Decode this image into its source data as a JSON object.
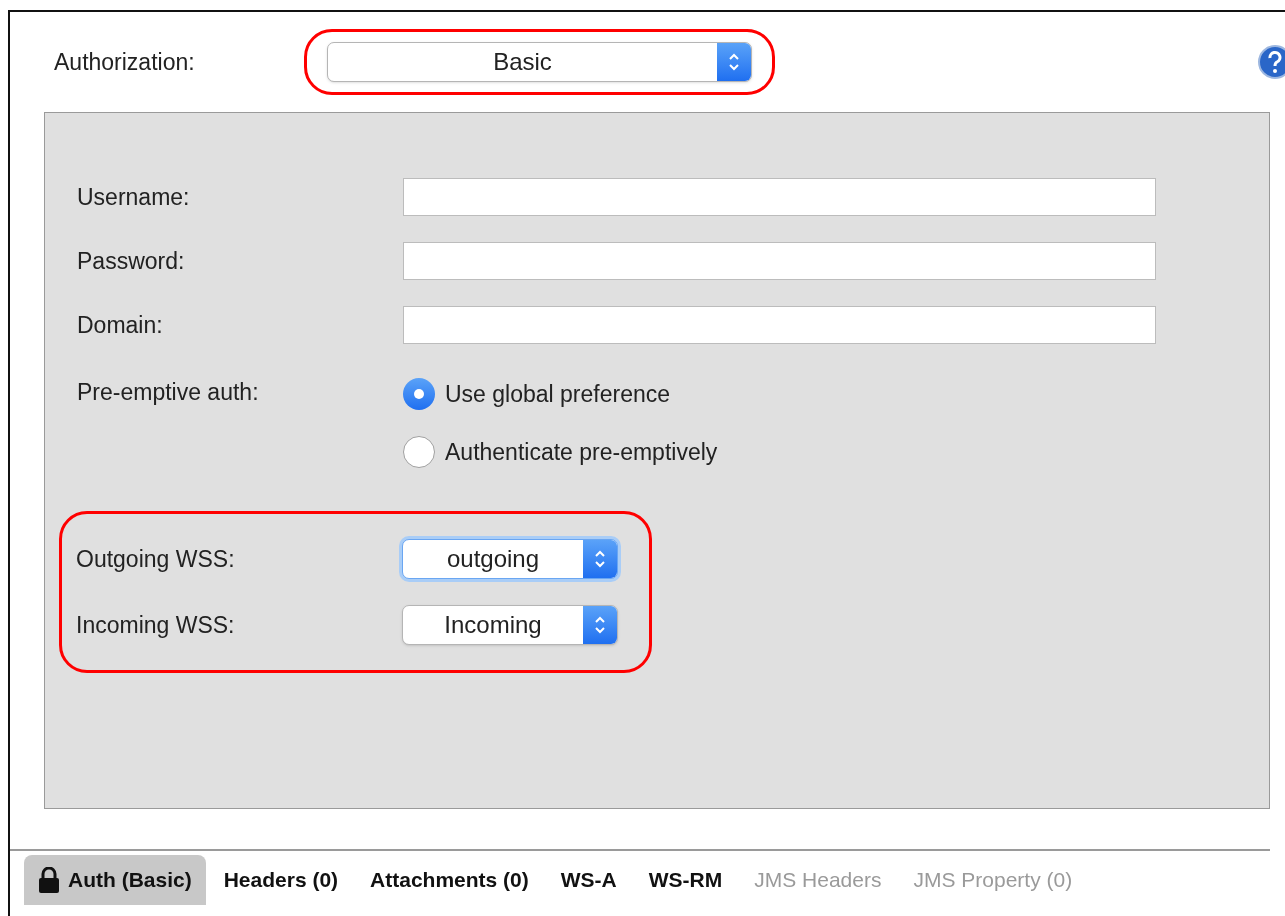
{
  "authorization": {
    "label": "Authorization:",
    "value": "Basic",
    "highlighted": true
  },
  "fields": [
    {
      "label": "Username:"
    },
    {
      "label": "Password:"
    },
    {
      "label": "Domain:"
    }
  ],
  "preemptive": {
    "label": "Pre-emptive auth:",
    "options": [
      {
        "label": "Use global preference",
        "selected": true
      },
      {
        "label": "Authenticate pre-emptively",
        "selected": false
      }
    ]
  },
  "wss": {
    "highlighted": true,
    "selects": [
      {
        "label": "Outgoing WSS:",
        "value": "outgoing",
        "focused": true
      },
      {
        "label": "Incoming WSS:",
        "value": "Incoming",
        "focused": false
      }
    ]
  },
  "tabs": [
    {
      "label": "Auth (Basic)",
      "selected": true,
      "disabled": false,
      "kind": "lock"
    },
    {
      "label": "Headers (0)",
      "selected": false,
      "disabled": false,
      "kind": "plain"
    },
    {
      "label": "Attachments (0)",
      "selected": false,
      "disabled": false,
      "kind": "plain"
    },
    {
      "label": "WS-A",
      "selected": false,
      "disabled": false,
      "kind": "plain"
    },
    {
      "label": "WS-RM",
      "selected": false,
      "disabled": false,
      "kind": "plain"
    },
    {
      "label": "JMS Headers",
      "selected": false,
      "disabled": true,
      "kind": "plain"
    },
    {
      "label": "JMS Property (0)",
      "selected": false,
      "disabled": true,
      "kind": "plain"
    }
  ]
}
